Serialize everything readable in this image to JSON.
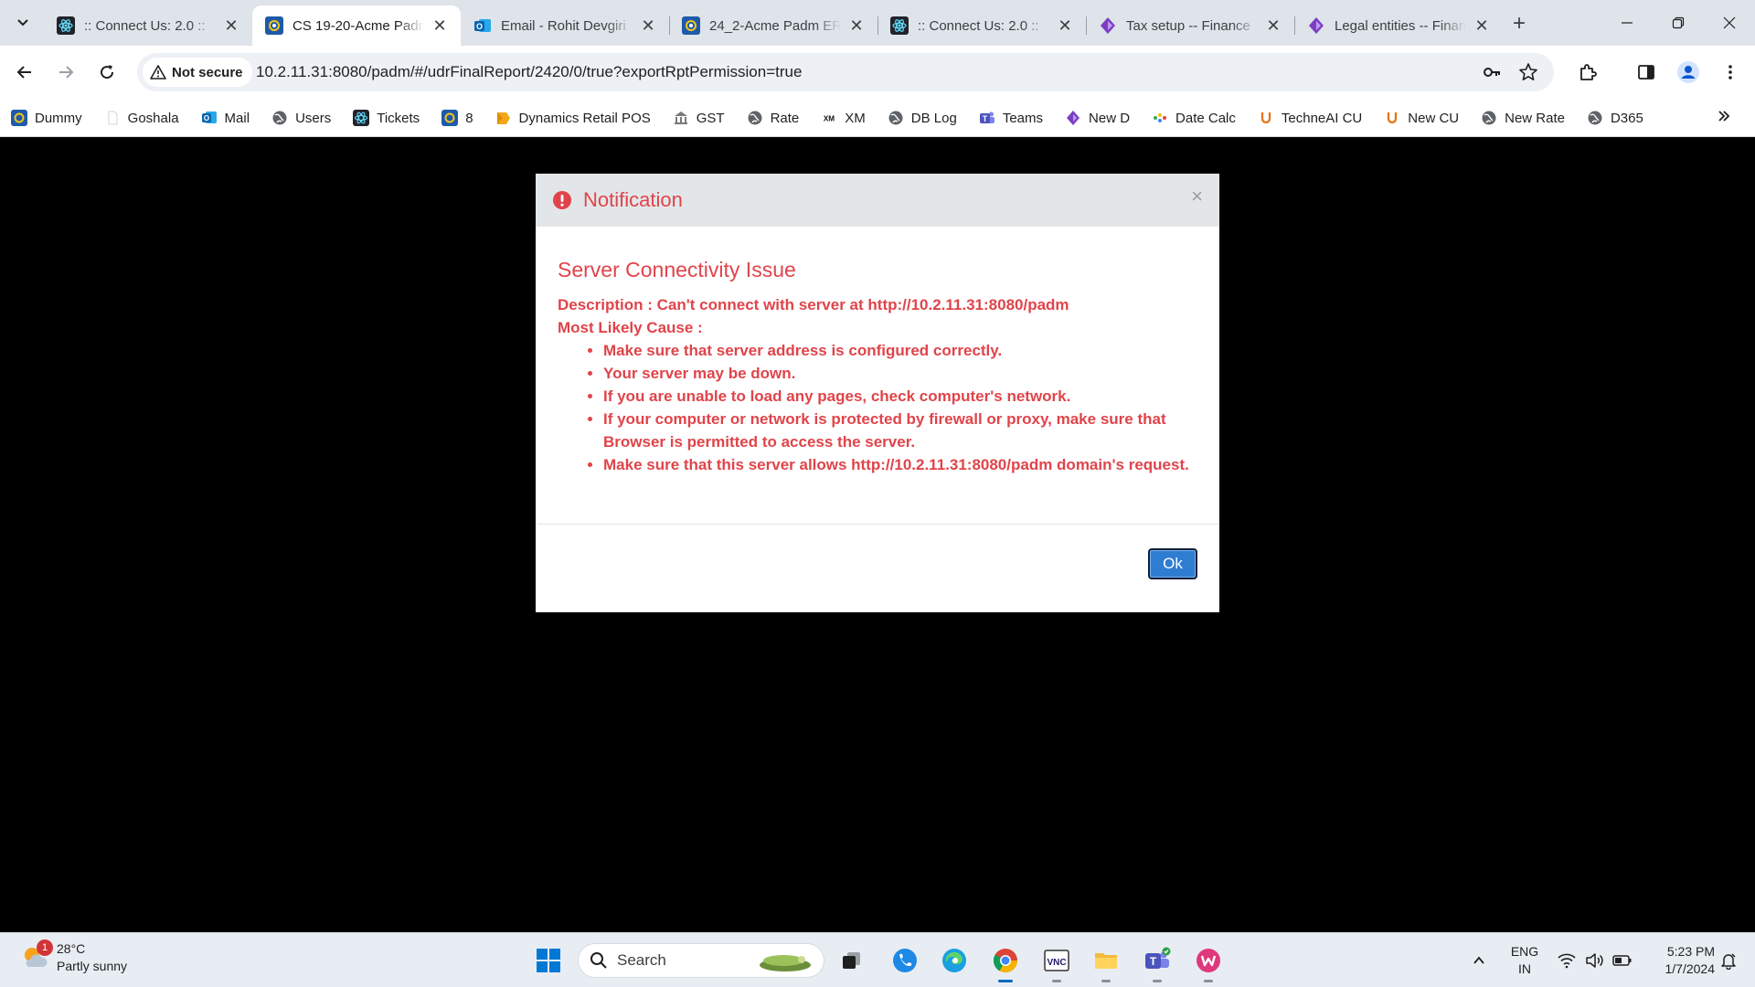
{
  "tabs": [
    {
      "title": ":: Connect Us: 2.0 ::",
      "active": false
    },
    {
      "title": "CS 19-20-Acme Padm",
      "active": true
    },
    {
      "title": "Email - Rohit Devgiri",
      "active": false
    },
    {
      "title": "24_2-Acme Padm ERP",
      "active": false
    },
    {
      "title": ":: Connect Us: 2.0 ::",
      "active": false
    },
    {
      "title": "Tax setup -- Finance",
      "active": false
    },
    {
      "title": "Legal entities -- Finance",
      "active": false
    }
  ],
  "close_glyph": "✕",
  "new_tab_glyph": "+",
  "address": {
    "security_label": "Not secure",
    "url": "10.2.11.31:8080/padm/#/udrFinalReport/2420/0/true?exportRptPermission=true"
  },
  "bookmarks": [
    {
      "label": "Dummy",
      "icon": "app-icon"
    },
    {
      "label": "Goshala",
      "icon": "blank-icon"
    },
    {
      "label": "Mail",
      "icon": "outlook-icon"
    },
    {
      "label": "Users",
      "icon": "globe-icon"
    },
    {
      "label": "Tickets",
      "icon": "react-icon"
    },
    {
      "label": "8",
      "icon": "app-icon"
    },
    {
      "label": "Dynamics Retail POS",
      "icon": "folder-icon"
    },
    {
      "label": "GST",
      "icon": "gst-icon"
    },
    {
      "label": "Rate",
      "icon": "globe-icon"
    },
    {
      "label": "XM",
      "icon": "xm-icon"
    },
    {
      "label": "DB Log",
      "icon": "globe-icon"
    },
    {
      "label": "Teams",
      "icon": "teams-icon"
    },
    {
      "label": "New D",
      "icon": "dynamics-icon"
    },
    {
      "label": "Date Calc",
      "icon": "dots-icon"
    },
    {
      "label": "TechneAI CU",
      "icon": "u-icon"
    },
    {
      "label": "New CU",
      "icon": "u-icon"
    },
    {
      "label": "New Rate",
      "icon": "globe-icon"
    },
    {
      "label": "D365",
      "icon": "globe-icon"
    }
  ],
  "modal": {
    "title": "Notification",
    "close_glyph": "×",
    "heading": "Server Connectivity Issue",
    "description": "Description : Can't connect with server at http://10.2.11.31:8080/padm",
    "cause_label": "Most Likely Cause :",
    "causes": [
      "Make sure that server address is configured correctly.",
      "Your server may be down.",
      "If you are unable to load any pages, check computer's network.",
      "If your computer or network is protected by firewall or proxy, make sure that Browser is permitted to access the server.",
      "Make sure that this server allows http://10.2.11.31:8080/padm domain's request."
    ],
    "ok_label": "Ok",
    "accent_color": "#e0444a"
  },
  "taskbar": {
    "weather_badge": "1",
    "temperature": "28°C",
    "condition": "Partly sunny",
    "search_placeholder": "Search",
    "lang_top": "ENG",
    "lang_bottom": "IN",
    "time": "5:23 PM",
    "date": "1/7/2024"
  }
}
